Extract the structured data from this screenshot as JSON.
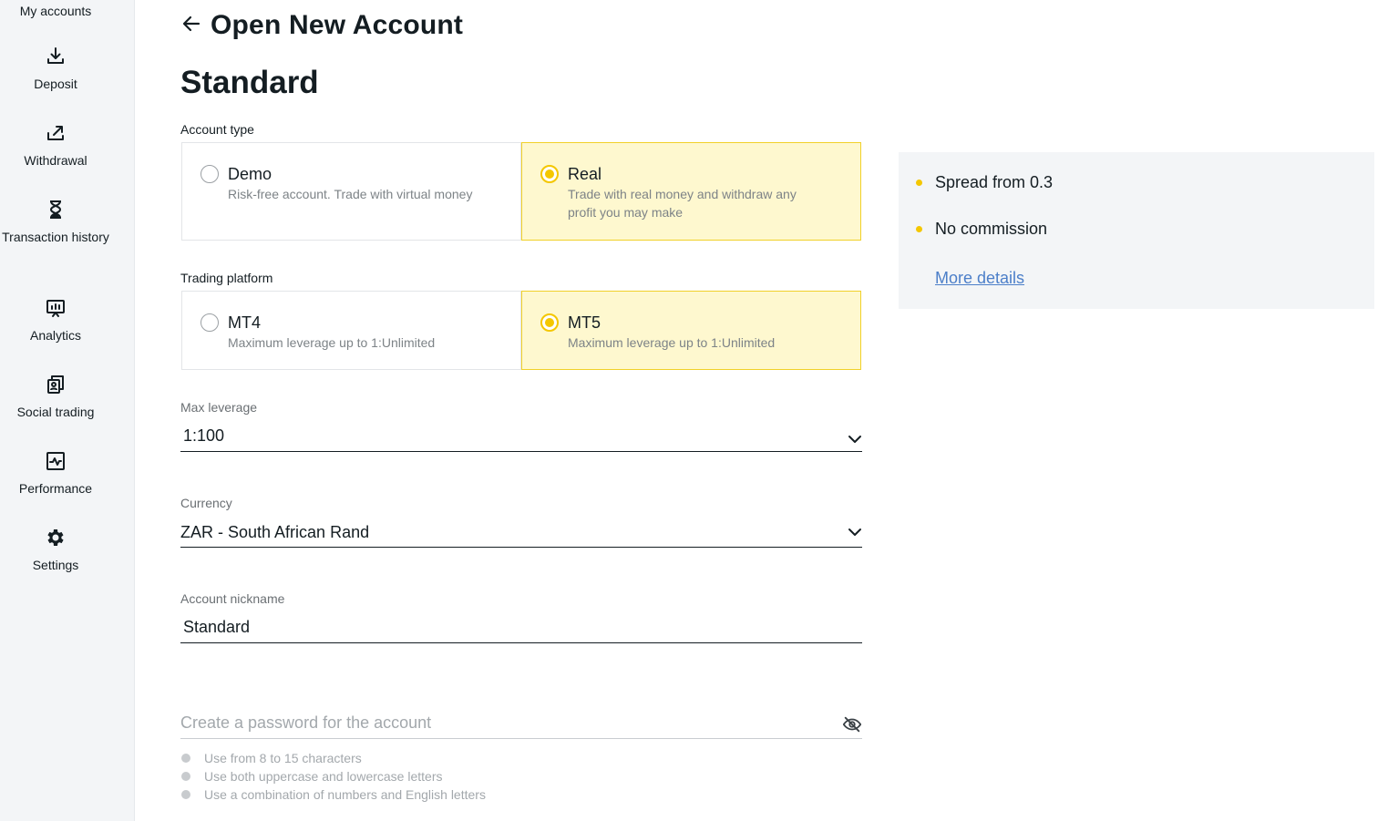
{
  "sidebar": {
    "top_label": "My accounts",
    "items": [
      {
        "label": "Deposit",
        "icon": "deposit-icon"
      },
      {
        "label": "Withdrawal",
        "icon": "withdrawal-icon"
      },
      {
        "label": "Transaction history",
        "icon": "hourglass-icon"
      },
      {
        "label": "Analytics",
        "icon": "analytics-icon"
      },
      {
        "label": "Social trading",
        "icon": "social-trading-icon"
      },
      {
        "label": "Performance",
        "icon": "performance-icon"
      },
      {
        "label": "Settings",
        "icon": "gear-icon"
      }
    ]
  },
  "header": {
    "title": "Open New Account",
    "back_icon": "arrow-left-icon"
  },
  "account_name": "Standard",
  "account_type": {
    "label": "Account type",
    "options": [
      {
        "title": "Demo",
        "desc": "Risk-free account. Trade with virtual money",
        "selected": false
      },
      {
        "title": "Real",
        "desc": "Trade with real money and withdraw any profit you may make",
        "selected": true
      }
    ]
  },
  "trading_platform": {
    "label": "Trading platform",
    "options": [
      {
        "title": "MT4",
        "desc": "Maximum leverage up to 1:Unlimited",
        "selected": false
      },
      {
        "title": "MT5",
        "desc": "Maximum leverage up to 1:Unlimited",
        "selected": true
      }
    ]
  },
  "max_leverage": {
    "label": "Max leverage",
    "value": "1:100"
  },
  "currency": {
    "label": "Currency",
    "value": "ZAR - South African Rand"
  },
  "nickname": {
    "label": "Account nickname",
    "value": "Standard"
  },
  "password": {
    "placeholder": "Create a password for the account",
    "eye_icon": "eye-off-icon",
    "rules": [
      "Use from 8 to 15 characters",
      "Use both uppercase and lowercase letters",
      "Use a combination of numbers and English letters"
    ]
  },
  "info_panel": {
    "features": [
      "Spread from 0.3",
      "No commission"
    ],
    "more_link": "More details"
  },
  "colors": {
    "accent": "#f4c700",
    "selected_bg": "#fef8cf",
    "sidebar_bg": "#f3f5f7",
    "link": "#4c7fc9"
  }
}
